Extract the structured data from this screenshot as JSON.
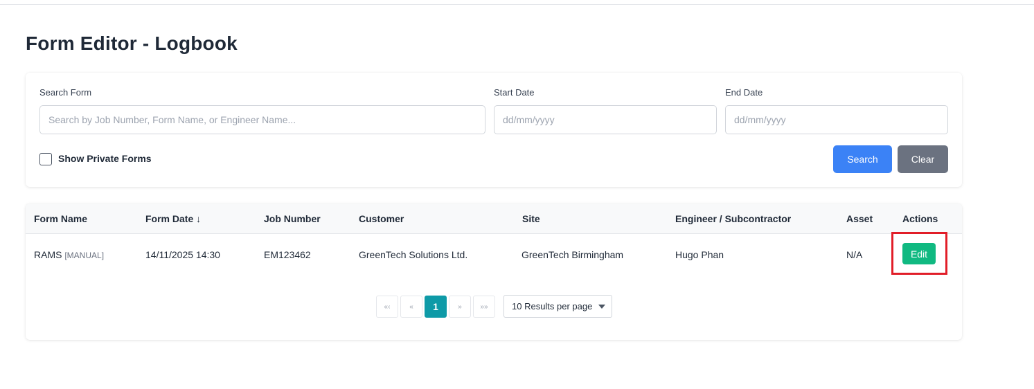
{
  "page": {
    "title": "Form Editor - Logbook"
  },
  "filters": {
    "search_label": "Search Form",
    "search_placeholder": "Search by Job Number, Form Name, or Engineer Name...",
    "start_label": "Start Date",
    "start_placeholder": "dd/mm/yyyy",
    "end_label": "End Date",
    "end_placeholder": "dd/mm/yyyy",
    "private_label": "Show Private Forms",
    "private_checked": false,
    "search_button": "Search",
    "clear_button": "Clear"
  },
  "table": {
    "columns": [
      "Form Name",
      "Form Date ↓",
      "Job Number",
      "Customer",
      "Site",
      "Engineer / Subcontractor",
      "Asset",
      "Actions"
    ],
    "rows": [
      {
        "form_name": "RAMS",
        "form_tag": "[MANUAL]",
        "form_date": "14/11/2025 14:30",
        "job_number": "EM123462",
        "customer": "GreenTech Solutions Ltd.",
        "site": "GreenTech Birmingham",
        "engineer": "Hugo Phan",
        "asset": "N/A",
        "action": "Edit"
      }
    ]
  },
  "pagination": {
    "first": "«‹",
    "prev": "«",
    "current": "1",
    "next": "»",
    "last": "»»",
    "per_page": "10 Results per page"
  },
  "colors": {
    "primary": "#3b82f6",
    "secondary": "#6b7280",
    "success": "#10b981",
    "active_page": "#0e9aa7",
    "highlight": "#e11d28"
  }
}
